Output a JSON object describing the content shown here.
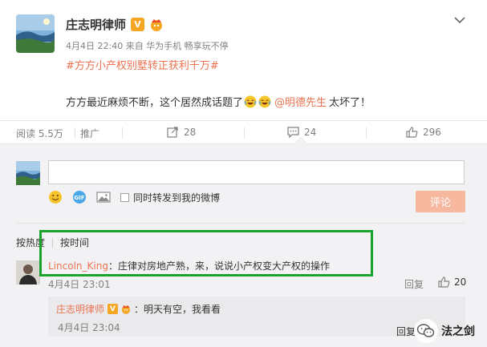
{
  "post": {
    "author": "庄志明律师",
    "verified_badge": "V",
    "meta": "4月4日 22:40 来自 华为手机 畅享玩不停",
    "topic": "#方方小产权别墅转正获利千万#",
    "content_before": "方方最近麻烦不断，这个居然成话题了",
    "mention": "@明德先生",
    "content_after": "太坏了！"
  },
  "actions": {
    "reads": "阅读 5.5万",
    "promote": "推广",
    "forward_count": "28",
    "comment_count": "24",
    "like_count": "296"
  },
  "composer": {
    "input_value": "",
    "checkbox_label": "同时转发到我的微博",
    "submit_label": "评论"
  },
  "sort": {
    "hot": "按热度",
    "time": "按时间"
  },
  "comments": [
    {
      "user": "Lincoln_King",
      "text": "：庄律对房地产熟，来，说说小产权变大产权的操作",
      "time": "4月4日 23:01",
      "reply_label": "回复",
      "likes": "20",
      "replies": [
        {
          "user": "庄志明律师",
          "text": "：明天有空，我看看",
          "time": "4月4日 23:04"
        }
      ]
    }
  ],
  "watermark": {
    "prefix": "回复",
    "name": "法之剑"
  },
  "colors": {
    "accent": "#eb7350",
    "highlight_box": "#1aa32a",
    "background": "#f2f2f5"
  }
}
